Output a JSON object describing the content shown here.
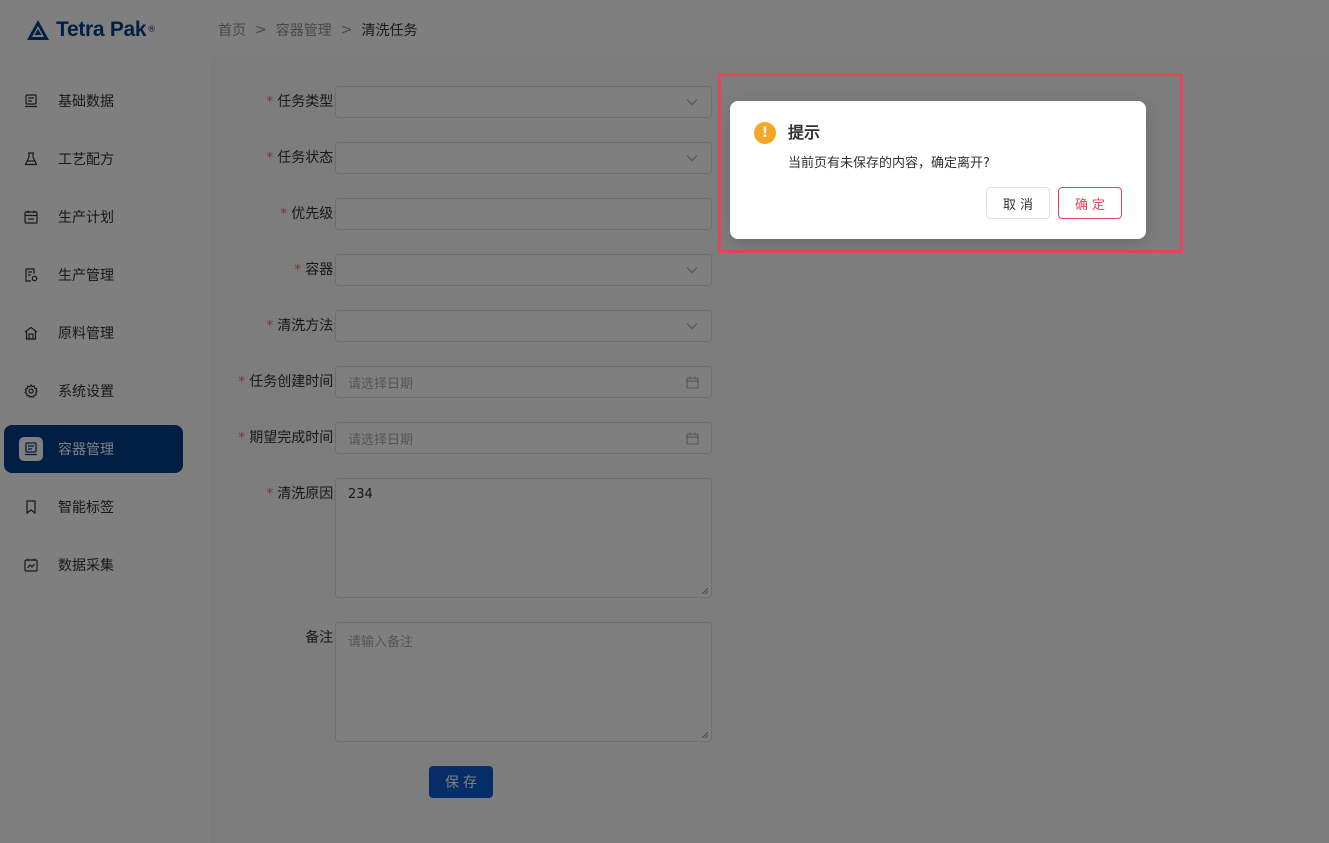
{
  "header": {
    "logo_text": "Tetra Pak",
    "logo_reg": "®",
    "breadcrumb": [
      "首页",
      "容器管理",
      "清洗任务"
    ],
    "breadcrumb_sep": ">"
  },
  "sidebar": {
    "items": [
      {
        "label": "基础数据",
        "icon": "database-icon"
      },
      {
        "label": "工艺配方",
        "icon": "flask-icon"
      },
      {
        "label": "生产计划",
        "icon": "calendar-icon"
      },
      {
        "label": "生产管理",
        "icon": "document-gear-icon"
      },
      {
        "label": "原料管理",
        "icon": "warehouse-icon"
      },
      {
        "label": "系统设置",
        "icon": "gear-icon"
      },
      {
        "label": "容器管理",
        "icon": "container-icon",
        "active": true
      },
      {
        "label": "智能标签",
        "icon": "bookmark-icon"
      },
      {
        "label": "数据采集",
        "icon": "chart-calendar-icon"
      }
    ]
  },
  "form": {
    "fields": [
      {
        "label": "任务类型",
        "required": true,
        "type": "select",
        "value": ""
      },
      {
        "label": "任务状态",
        "required": true,
        "type": "select",
        "value": ""
      },
      {
        "label": "优先级",
        "required": true,
        "type": "input",
        "value": ""
      },
      {
        "label": "容器",
        "required": true,
        "type": "select",
        "value": ""
      },
      {
        "label": "清洗方法",
        "required": true,
        "type": "select",
        "value": ""
      },
      {
        "label": "任务创建时间",
        "required": true,
        "type": "date",
        "placeholder": "请选择日期"
      },
      {
        "label": "期望完成时间",
        "required": true,
        "type": "date",
        "placeholder": "请选择日期"
      },
      {
        "label": "清洗原因",
        "required": true,
        "type": "textarea",
        "value": "234"
      },
      {
        "label": "备注",
        "required": false,
        "type": "textarea",
        "placeholder": "请输入备注"
      }
    ],
    "label_suffix": ":",
    "required_mark": "*",
    "save_label": "保存"
  },
  "dialog": {
    "title": "提示",
    "icon": "warning-icon",
    "icon_glyph": "!",
    "message": "当前页有未保存的内容，确定离开?",
    "cancel_label": "取消",
    "confirm_label": "确定"
  },
  "colors": {
    "brand": "#023f88",
    "primary_button": "#0b5bd3",
    "danger": "#e8445a",
    "warning": "#f5a623"
  }
}
